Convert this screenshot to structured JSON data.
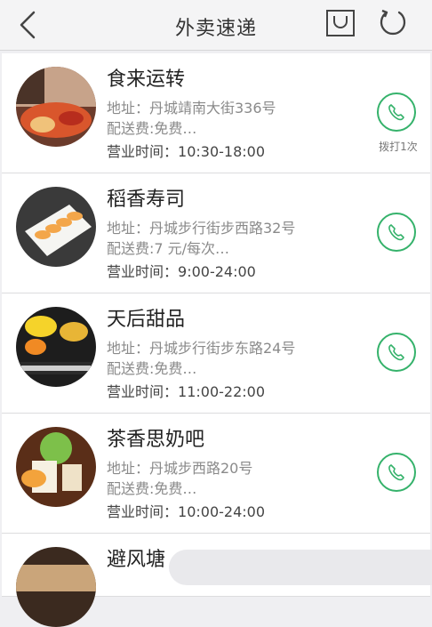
{
  "header": {
    "title": "外卖速递"
  },
  "colors": {
    "accent": "#35b26b"
  },
  "restaurants": [
    {
      "name": "食来运转",
      "address": "地址：丹城靖南大街336号",
      "fee": "配送费:免费…",
      "hours_label": "营业时间：",
      "hours": "10:30-18:00",
      "calls": "拨打1次"
    },
    {
      "name": "稻香寿司",
      "address": "地址：丹城步行街步西路32号",
      "fee": "配送费:7 元/每次…",
      "hours_label": "营业时间：",
      "hours": "9:00-24:00"
    },
    {
      "name": "天后甜品",
      "address": "地址：丹城步行街步东路24号",
      "fee": "配送费:免费…",
      "hours_label": "营业时间：",
      "hours": "11:00-22:00"
    },
    {
      "name": "茶香思奶吧",
      "address": "地址：丹城步西路20号",
      "fee": "配送费:免费…",
      "hours_label": "营业时间：",
      "hours": "10:00-24:00"
    },
    {
      "name": "避风塘"
    }
  ]
}
